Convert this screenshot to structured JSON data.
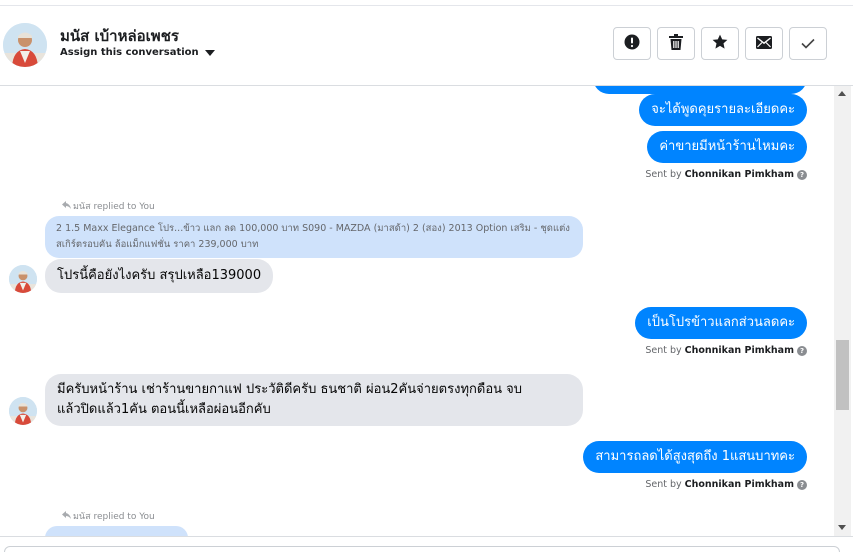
{
  "header": {
    "contact_name": "มนัส เบ้าหล่อเพชร",
    "assign_label": "Assign this conversation",
    "actions": [
      {
        "name": "report-spam-button",
        "icon": "exclamation-icon"
      },
      {
        "name": "delete-button",
        "icon": "trash-icon"
      },
      {
        "name": "star-button",
        "icon": "star-icon"
      },
      {
        "name": "mark-unread-button",
        "icon": "envelope-icon"
      },
      {
        "name": "mark-done-button",
        "icon": "checkmark-icon"
      }
    ]
  },
  "messages": {
    "out_1": "จะได้พูดคุยรายละเอียดคะ",
    "out_2": "ค่าขายมีหน้าร้านไหมคะ",
    "sent_prefix": "Sent by",
    "sent_agent": "Chonnikan Pimkham",
    "replied_label": "มนัส replied to You",
    "quote_text": "2 1.5 Maxx Elegance โปร...ข้าว แลก ลด 100,000 บาท S090 - MAZDA (มาสด้า) 2 (สอง) 2013 Option เสริม - ชุดแต่งสเกิร์ตรอบคัน ล้อแม็กแฟชั่น ราคา 239,000 บาท",
    "in_1": "โปรนี้คือยังไงครับ  สรุปเหลือ139000",
    "out_3": "เป็นโปรข้าวแลกส่วนลดคะ",
    "in_2_line1": "มีครับหน้าร้าน  เช่าร้านขายกาแฟ  ประวัติดีครับ  ธนชาติ   ผ่อน2คันจ่ายตรงทุกดือน  จบ",
    "in_2_line2": "แล้วปิดแล้ว1คัน  ตอนนี้เหลือผ่อนอีกคับ",
    "out_4": "สามารถลดได้สูงสุดถึง 1แสนบาทคะ",
    "replied_label_2": "มนัส replied to You"
  },
  "colors": {
    "outgoing_bubble": "#0084ff",
    "incoming_bubble": "#e4e6eb",
    "quote_bubble": "#cfe2fb"
  }
}
